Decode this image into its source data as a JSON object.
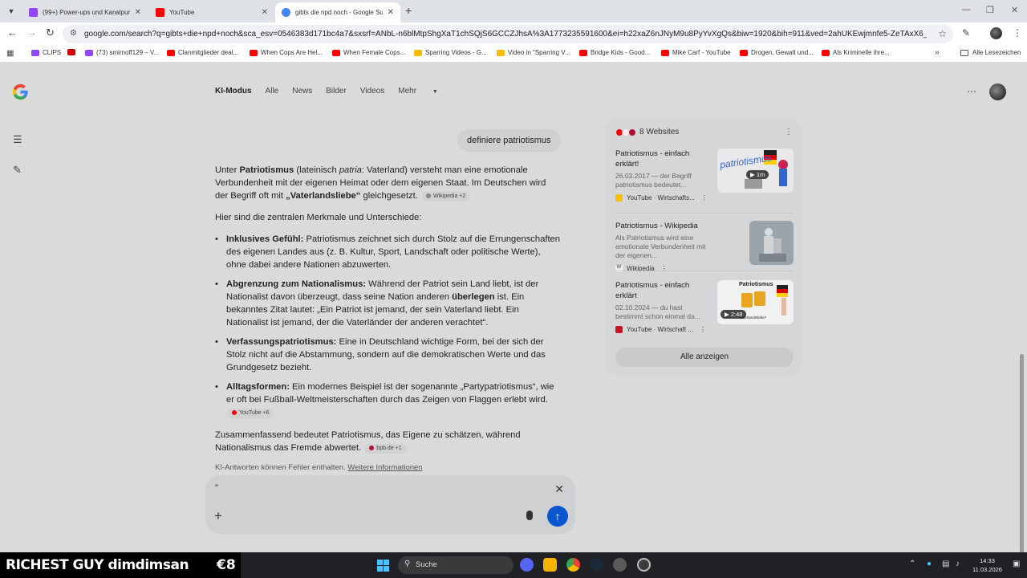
{
  "browser": {
    "tabs": [
      {
        "title": "(99+) Power-ups und Kanalpun",
        "favicon_color": "#9146ff",
        "active": false
      },
      {
        "title": "YouTube",
        "favicon_color": "#ff0000",
        "active": false
      },
      {
        "title": "gibts die npd noch - Google Su",
        "favicon_color": "#4285f4",
        "active": true
      }
    ],
    "url": "google.com/search?q=gibts+die+npd+noch&sca_esv=0546383d171bc4a7&sxsrf=ANbL-n6blMtpShgXaT1chSQjS6GCCZJhsA%3A1773235591600&ei=h22xaZ6nJNyM9u8PyYvXgQs&biw=1920&bih=911&ved=2ahUKEwjmnfe5-ZeTAxX6_7sIHYj9GEYQ0NsO...",
    "bookmarks": [
      {
        "label": "CLIPS",
        "color": "#9146ff"
      },
      {
        "label": "",
        "color": "#d00000"
      },
      {
        "label": "(73) smirnoff129 – V...",
        "color": "#9146ff"
      },
      {
        "label": "Clanmitglieder deal...",
        "color": "#ff0000"
      },
      {
        "label": "When Cops Are Hel...",
        "color": "#ff0000"
      },
      {
        "label": "When Female Cops...",
        "color": "#ff0000"
      },
      {
        "label": "Sparring Videos - G...",
        "color": "#fbbc05"
      },
      {
        "label": "Video in \"Sparring V...",
        "color": "#fbbc05"
      },
      {
        "label": "Bridge Kids - Good...",
        "color": "#ff0000"
      },
      {
        "label": "Mike Carf - YouTube",
        "color": "#ff0000"
      },
      {
        "label": "Drogen, Gewalt und...",
        "color": "#ff0000"
      },
      {
        "label": "Als Kriminelle ihre...",
        "color": "#ff0000"
      }
    ],
    "all_bookmarks_label": "Alle Lesezeichen"
  },
  "search_tabs": [
    "KI-Modus",
    "Alle",
    "News",
    "Bilder",
    "Videos",
    "Mehr"
  ],
  "conversation": {
    "user_query": "definiere patriotismus",
    "intro_1": "Unter ",
    "intro_bold": "Patriotismus",
    "intro_2": " (lateinisch ",
    "intro_ital": "patria",
    "intro_3": ": Vaterland) versteht man eine emotionale Verbundenheit mit der eigenen Heimat oder dem eigenen Staat. Im Deutschen wird der Begriff oft mit ",
    "intro_bold2": "„Vaterlandsliebe“",
    "intro_4": " gleichgesetzt.",
    "intro_chip": "Wikipedia +2",
    "lead": "Hier sind die zentralen Merkmale und Unterschiede:",
    "points": [
      {
        "term": "Inklusives Gefühl:",
        "text": " Patriotismus zeichnet sich durch Stolz auf die Errungenschaften des eigenen Landes aus (z. B. Kultur, Sport, Landschaft oder politische Werte), ohne dabei andere Nationen abzuwerten."
      },
      {
        "term": "Abgrenzung zum Nationalismus:",
        "text_a": " Während der Patriot sein Land liebt, ist der Nationalist davon überzeugt, dass seine Nation anderen ",
        "bold_mid": "überlegen",
        "text_b": " ist. Ein bekanntes Zitat lautet: „Ein Patriot ist jemand, der sein Vaterland liebt. Ein Nationalist ist jemand, der die Vaterländer der anderen verachtet“."
      },
      {
        "term": "Verfassungspatriotismus:",
        "text": " Eine in Deutschland wichtige Form, bei der sich der Stolz nicht auf die Abstammung, sondern auf die demokratischen Werte und das Grundgesetz bezieht."
      },
      {
        "term": "Alltagsformen:",
        "text": " Ein modernes Beispiel ist der sogenannte „Partypatriotismus“, wie er oft bei Fußball-Weltmeisterschaften durch das Zeigen von Flaggen erlebt wird.",
        "chip": "YouTube +6"
      }
    ],
    "summary": "Zusammenfassend bedeutet Patriotismus, das Eigene zu schätzen, während Nationalismus das Fremde abwertet.",
    "summary_chip": "bpb.de +1",
    "disclaimer": "KI-Antworten können Fehler enthalten.",
    "disclaimer_link": "Weitere Informationen"
  },
  "sources": {
    "header": "8 Websites",
    "cards": [
      {
        "title": "Patriotismus - einfach erklärt!",
        "snippet": "26.03.2017 — der Begriff patriotismus bedeutet...",
        "source": "YouTube · Wirtschafts...",
        "badge": "1m",
        "thumb_text": "patriotismus"
      },
      {
        "title": "Patriotismus - Wikipedia",
        "snippet": "Als Patriotismus wird eine emotionale Verbundenheit mit der eigenen...",
        "source": "Wikipedia"
      },
      {
        "title": "Patriotismus - einfach erklärt",
        "snippet": "02.10.2024 — du hast bestimmt schon einmal da...",
        "source": "YouTube · Wirtschaft ...",
        "badge": "2:48",
        "thumb_text": "Patriotismus",
        "thumb_text2": "Vaterlandsliebe?"
      }
    ],
    "show_all": "Alle anzeigen"
  },
  "input": {
    "value": "\""
  },
  "taskbar": {
    "stream_name": "RICHEST GUY dimdimsan",
    "stream_amount": "€8",
    "search_label": "Suche",
    "time": "14:33",
    "date": "11.03.2026"
  },
  "colors": {
    "send": "#0b57d0",
    "accent_blue": "#4285f4"
  }
}
